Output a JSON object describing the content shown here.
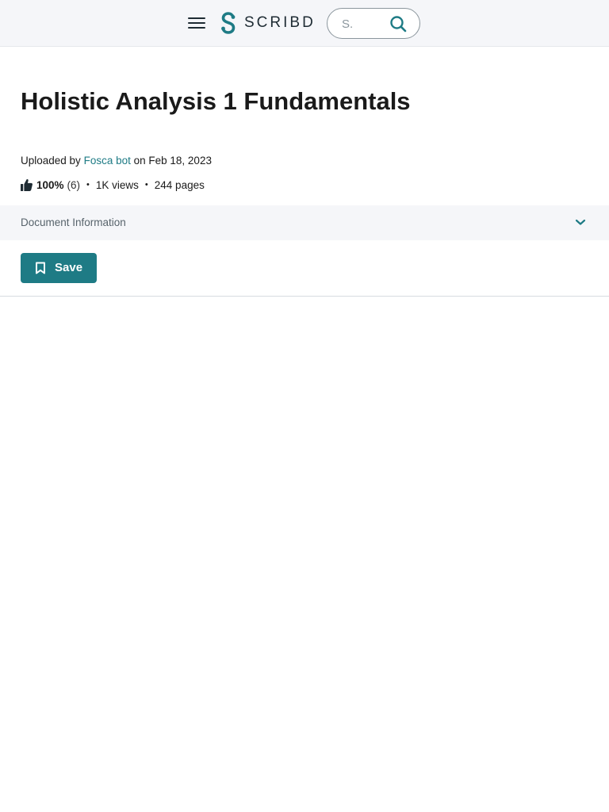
{
  "header": {
    "logo_text": "SCRIBD",
    "search_placeholder": "S.",
    "icons": {
      "menu": "hamburger-menu-icon",
      "logo": "scribd-logo-icon",
      "search": "search-icon"
    }
  },
  "document": {
    "title": "Holistic Analysis 1 Fundamentals",
    "uploaded_prefix": "Uploaded by",
    "author": "Fosca bot",
    "uploaded_on": "on Feb 18, 2023",
    "rating_percent": "100%",
    "rating_count": "(6)",
    "views": "1K views",
    "pages": "244 pages",
    "separator": "•"
  },
  "doc_info": {
    "label": "Document Information",
    "expanded": false
  },
  "actions": {
    "save_label": "Save"
  },
  "colors": {
    "accent": "#1e7b85",
    "header_bg": "#f5f6f9",
    "text_dark": "#1a1a1a",
    "text_muted": "#57636b"
  }
}
